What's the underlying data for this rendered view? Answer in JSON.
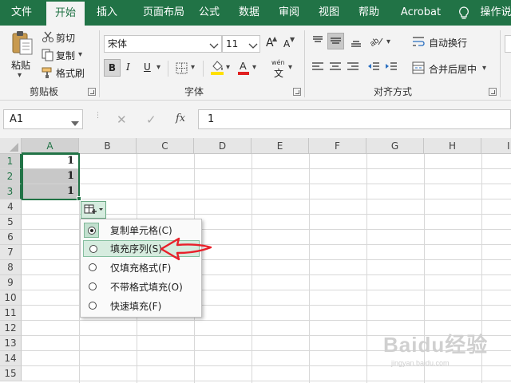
{
  "ribbon_tabs": [
    "文件",
    "开始",
    "插入",
    "页面布局",
    "公式",
    "数据",
    "审阅",
    "视图",
    "帮助",
    "Acrobat",
    "操作说"
  ],
  "active_tab": "开始",
  "clipboard": {
    "paste": "粘贴",
    "cut": "剪切",
    "copy": "复制",
    "format_painter": "格式刷",
    "group": "剪贴板"
  },
  "font": {
    "name": "宋体",
    "size": "11",
    "grow": "A",
    "shrink": "A",
    "bold": "B",
    "italic": "I",
    "underline": "U",
    "phonetic": "wén",
    "group": "字体"
  },
  "alignment": {
    "wrap_text": "自动换行",
    "merge_center": "合并后居中",
    "group": "对齐方式"
  },
  "name_box": "A1",
  "formula_cancel": "✕",
  "formula_enter": "✓",
  "formula_fx": "fx",
  "formula_value": "1",
  "columns": [
    "A",
    "B",
    "C",
    "D",
    "E",
    "F",
    "G",
    "H",
    "I"
  ],
  "rows": [
    "1",
    "2",
    "3",
    "4",
    "5",
    "6",
    "7",
    "8",
    "9",
    "10",
    "11",
    "12",
    "13",
    "14",
    "15"
  ],
  "cells": {
    "A1": "1",
    "A2": "1",
    "A3": "1"
  },
  "autofill_menu": {
    "items": [
      {
        "label": "复制单元格(C)",
        "selected": true
      },
      {
        "label": "填充序列(S)",
        "selected": false
      },
      {
        "label": "仅填充格式(F)",
        "selected": false
      },
      {
        "label": "不带格式填充(O)",
        "selected": false
      },
      {
        "label": "快速填充(F)",
        "selected": false
      }
    ]
  },
  "watermark": {
    "brand": "Baidu经验",
    "url": "jingyan.baidu.com"
  },
  "colors": {
    "excel_green": "#217346",
    "annotation_red": "#e8202a",
    "font_color": "#e02020",
    "highlight_yellow": "#ffe000"
  }
}
